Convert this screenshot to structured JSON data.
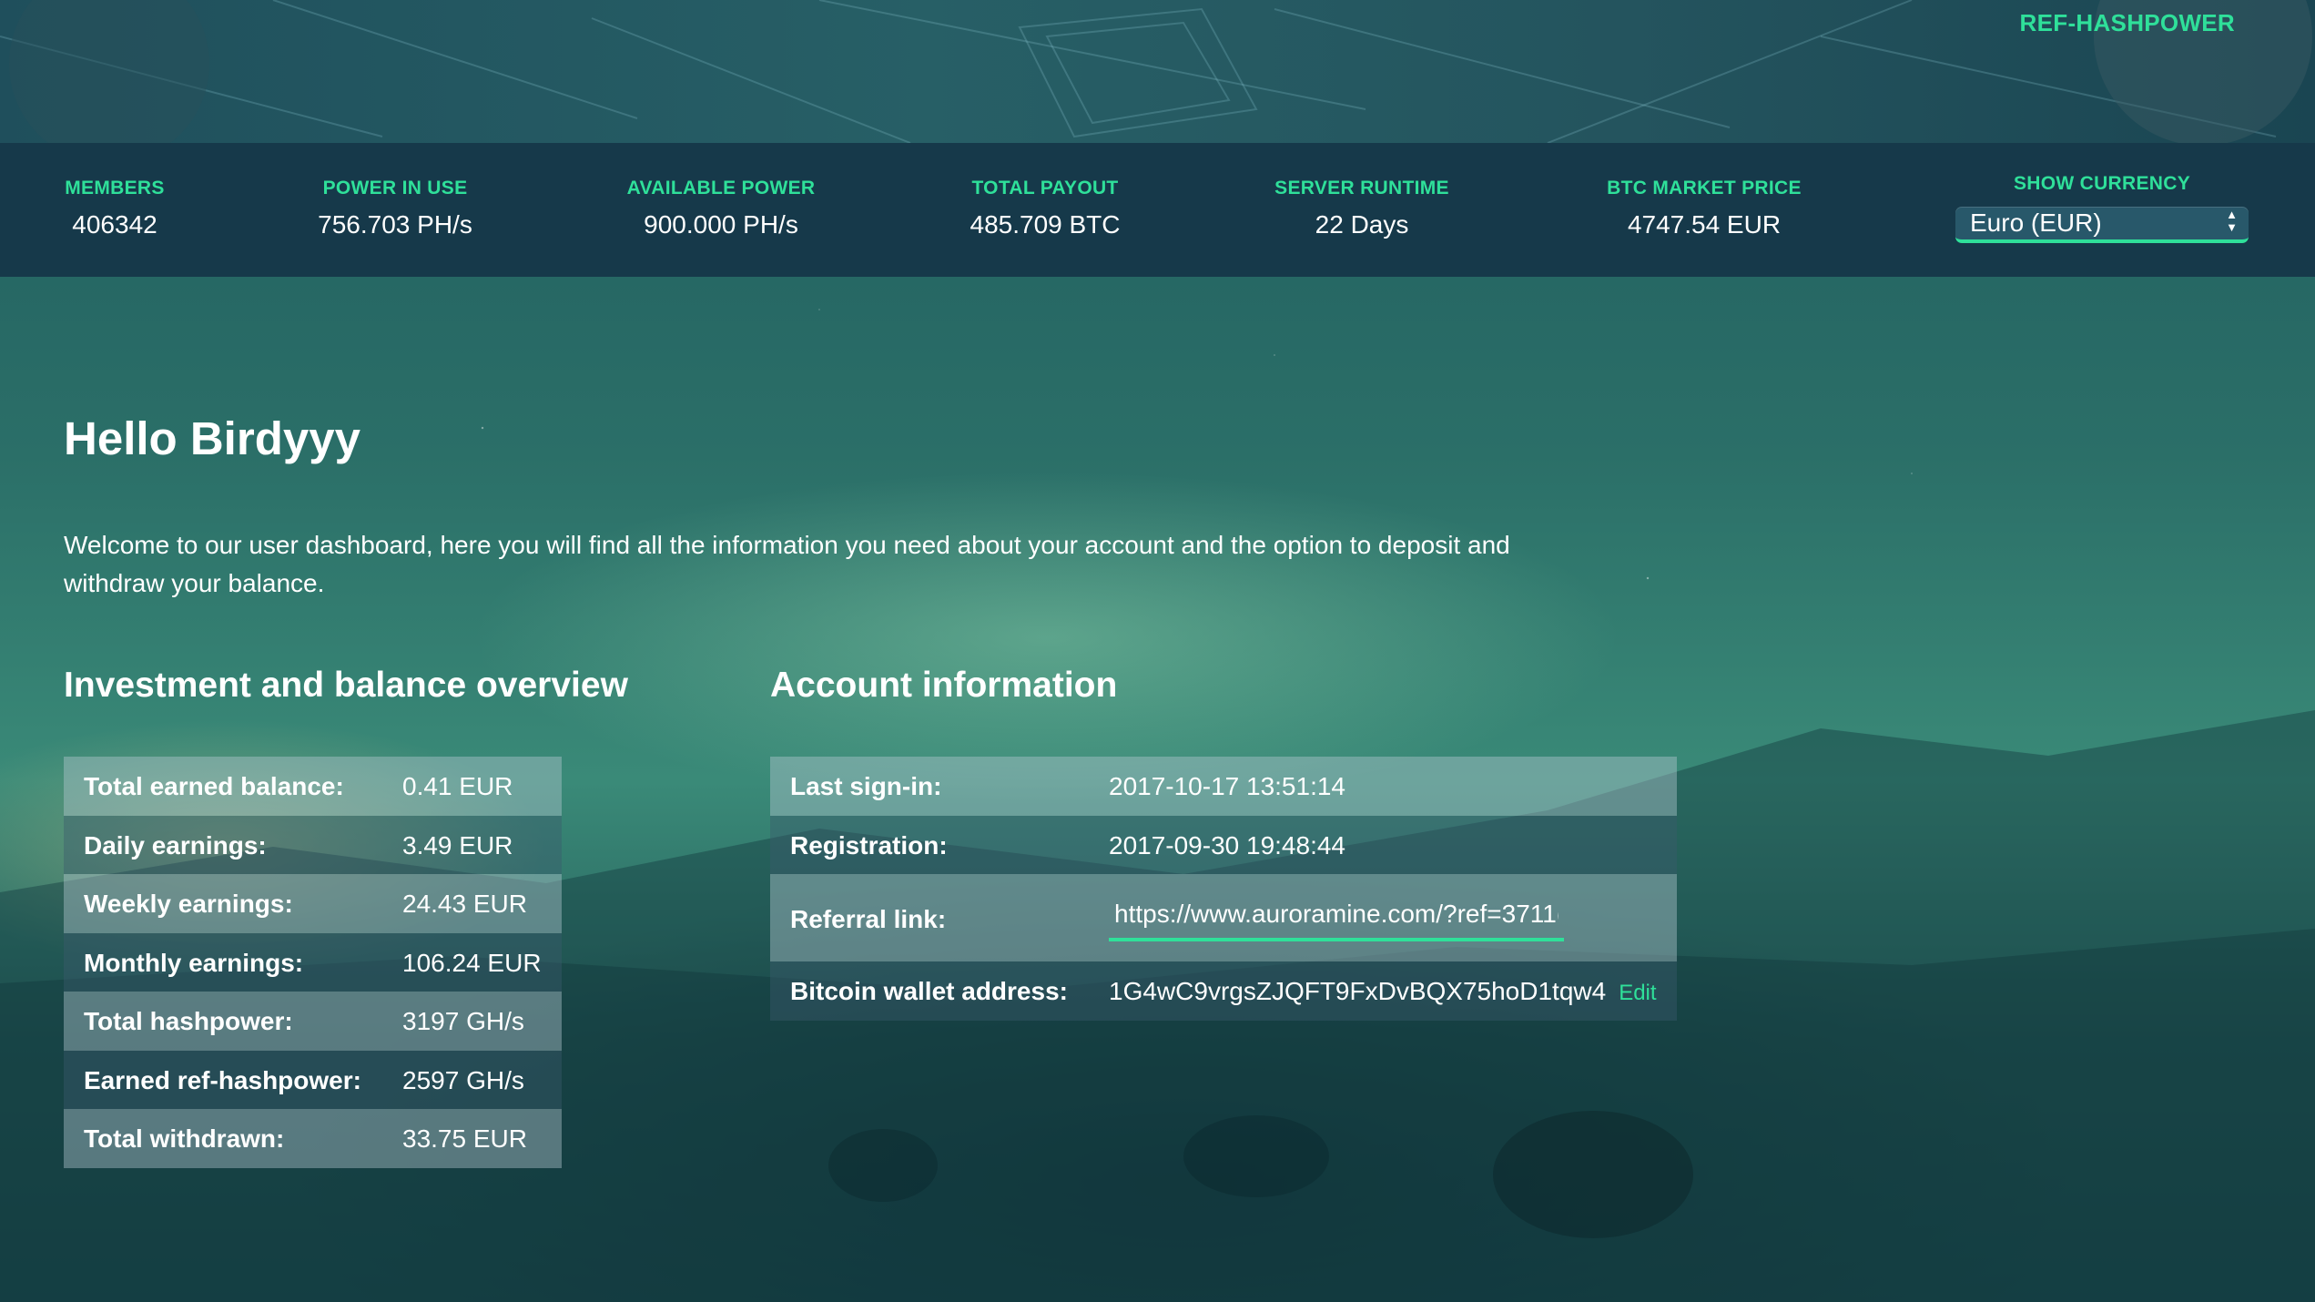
{
  "header": {
    "ref_link": "REF-HASHPOWER"
  },
  "stats": [
    {
      "label": "MEMBERS",
      "value": "406342"
    },
    {
      "label": "POWER IN USE",
      "value": "756.703 PH/s"
    },
    {
      "label": "AVAILABLE POWER",
      "value": "900.000 PH/s"
    },
    {
      "label": "TOTAL PAYOUT",
      "value": "485.709 BTC"
    },
    {
      "label": "SERVER RUNTIME",
      "value": "22 Days"
    },
    {
      "label": "BTC MARKET PRICE",
      "value": "4747.54 EUR"
    }
  ],
  "currency": {
    "label": "SHOW CURRENCY",
    "selected": "Euro (EUR)"
  },
  "greeting": "Hello Birdyyy",
  "intro": "Welcome to our user dashboard, here you will find all the information you need about your account and the option to deposit and withdraw your balance.",
  "investment": {
    "title": "Investment and balance overview",
    "rows": [
      {
        "label": "Total earned balance:",
        "value": "0.41 EUR"
      },
      {
        "label": "Daily earnings:",
        "value": "3.49 EUR"
      },
      {
        "label": "Weekly earnings:",
        "value": "24.43 EUR"
      },
      {
        "label": "Monthly earnings:",
        "value": "106.24 EUR"
      },
      {
        "label": "Total hashpower:",
        "value": "3197 GH/s"
      },
      {
        "label": "Earned ref-hashpower:",
        "value": "2597 GH/s"
      },
      {
        "label": "Total withdrawn:",
        "value": "33.75 EUR"
      }
    ]
  },
  "account": {
    "title": "Account information",
    "last_signin_label": "Last sign-in:",
    "last_signin": "2017-10-17 13:51:14",
    "registration_label": "Registration:",
    "registration": "2017-09-30 19:48:44",
    "referral_label": "Referral link:",
    "referral_value": "https://www.auroramine.com/?ref=3711(",
    "wallet_label": "Bitcoin wallet address:",
    "wallet": "1G4wC9vrgsZJQFT9FxDvBQX75hoD1tqw4",
    "edit_label": "Edit"
  },
  "colors": {
    "accent": "#2fe09a",
    "stats_bar": "#16394a"
  }
}
